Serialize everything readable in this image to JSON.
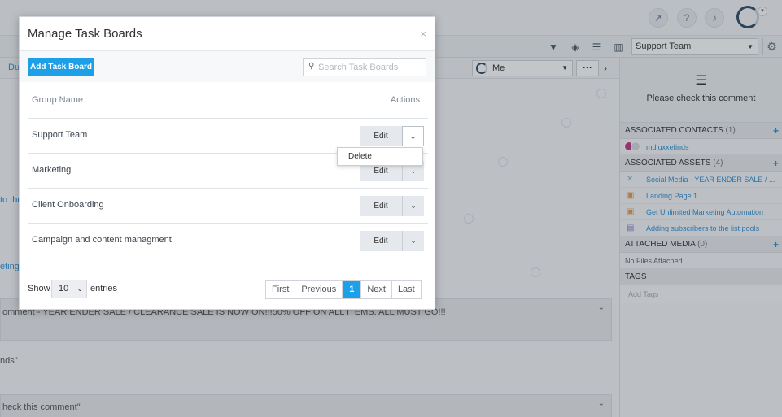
{
  "app": {
    "team_selector": "Support Team",
    "assignee_filter": "Me",
    "left_fragments": [
      "Du",
      "to the",
      "eting"
    ],
    "comment_bars": [
      "omment - YEAR ENDER SALE / CLEARANCE SALE IS NOW ON!!!50% OFF ON ALL ITEMS. ALL MUST GO!!!",
      "heck this comment\""
    ],
    "plain_fragment": "nds\""
  },
  "right_panel": {
    "note": "Please check this comment",
    "associated_contacts": {
      "title": "ASSOCIATED CONTACTS",
      "count": "(1)",
      "items": [
        "mdluxxefinds"
      ]
    },
    "associated_assets": {
      "title": "ASSOCIATED ASSETS",
      "count": "(4)",
      "items": [
        "Social Media - YEAR ENDER SALE / ...",
        "Landing Page 1",
        "Get Unlimited Marketing Automation",
        "Adding subscribers to the list pools"
      ]
    },
    "attached_media": {
      "title": "ATTACHED MEDIA",
      "count": "(0)",
      "empty": "No Files Attached"
    },
    "tags": {
      "title": "TAGS",
      "placeholder": "Add Tags"
    }
  },
  "modal": {
    "title": "Manage Task Boards",
    "close_glyph": "×",
    "add_button": "Add Task Board",
    "search_placeholder": "Search Task Boards",
    "columns": {
      "name": "Group Name",
      "actions": "Actions"
    },
    "rows": [
      {
        "name": "Support Team",
        "edit": "Edit"
      },
      {
        "name": "Marketing",
        "edit": "Edit"
      },
      {
        "name": "Client Onboarding",
        "edit": "Edit"
      },
      {
        "name": "Campaign and content managment",
        "edit": "Edit"
      }
    ],
    "dropdown_item": "Delete",
    "show_label": "Show",
    "entries_value": "10",
    "entries_label": "entries",
    "pagination": {
      "first": "First",
      "previous": "Previous",
      "current": "1",
      "next": "Next",
      "last": "Last"
    }
  },
  "colors": {
    "accent": "#1ea0e8",
    "link": "#2d8fd6"
  }
}
